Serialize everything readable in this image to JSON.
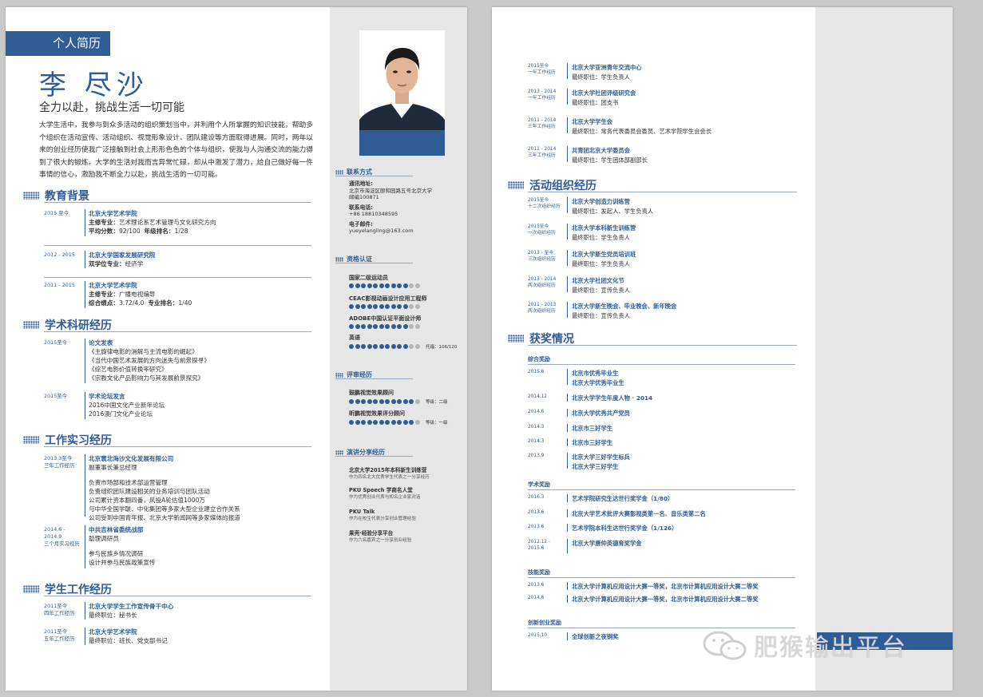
{
  "page1": {
    "badge": "个人简历",
    "name": "李 尽沙",
    "motto": "全力以赴，挑战生活一切可能",
    "intro": "大学生活中，我参与到众多活动的组织策划当中，并利用个人所掌握的知识技能，帮助多个组织在活动宣传、活动组织、视觉形象设计、团队建设等方面取得进展。同时，两年以来的创业经历使我广泛接触到社会上形形色色的个体与组织，使我与人沟通交流的能力得到了很大的锻炼。大学的生活对我而言异常忙碌，却从中激发了潜力，给自己做好每一件事情的信心，激励我不断全力以赴，挑战生活的一切可能。",
    "sections": {
      "education": "教育背景",
      "research": "学术科研经历",
      "work": "工作实习经历",
      "student": "学生工作经历"
    },
    "education": [
      {
        "date": "2015 至今",
        "school": "北京大学艺术学院",
        "l1k": "主修专业：",
        "l1v": "艺术理论系艺术管理与文化研究方向",
        "l2k": "平均分数：",
        "l2v": "92/100",
        "l2k2": "年级排名：",
        "l2v2": "1/28"
      },
      {
        "date": "2012 - 2015",
        "school": "北京大学国家发展研究院",
        "l1k": "双学位专业：",
        "l1v": "经济学"
      },
      {
        "date": "2011 - 2015",
        "school": "北京大学艺术学院",
        "l1k": "主修专业：",
        "l1v": "广播电视编导",
        "l2k": "综合绩点：",
        "l2v": "3.72/4.0",
        "l2k2": "专业排名：",
        "l2v2": "1/40"
      }
    ],
    "research": [
      {
        "date": "2015至今",
        "title": "论文发表",
        "lines": [
          "《主旋律电影的消解与主流电影的崛起》",
          "《当代中国艺术发展的方向迷失与前景探寻》",
          "《综艺电影价值转换率研究》",
          "《宗教文化产品影响力与其发展前景探究》"
        ]
      },
      {
        "date": "2015至今",
        "title": "学术论坛发言",
        "lines": [
          "2016中国文化产业新年论坛",
          "2016澳门文化产业论坛"
        ]
      }
    ],
    "work": [
      {
        "date": "2013.3至今",
        "date2": "三年工作经历",
        "title": "北京寰北海沙文化发展有限公司",
        "role": "副董事长兼总经理",
        "lines": [
          "负责市场部和技术部运营管理",
          "负责组织团队建设相关的业务培训与团队活动",
          "公司累计资本翻四番，风投A轮估值1000万",
          "与中华全国学联、中化集团等多家大型企业建立合作关系",
          "公司受到中国青年报、北京大学新闻网等多家媒体的报道"
        ]
      },
      {
        "date": "2014.6 - 2014.9",
        "date2": "三个月实习经历",
        "title": "中共吉林省委统战部",
        "role": "助理调研员",
        "lines": [
          "参与民族乡情况调研",
          "设计并参与民族政策宣传"
        ]
      }
    ],
    "student": [
      {
        "date": "2011至今",
        "date2": "四年工作经历",
        "title": "北京大学学生工作宣传骨干中心",
        "line": "最终职位：秘书长"
      },
      {
        "date": "2011至今",
        "date2": "五年工作经历",
        "title": "北京大学艺术学院",
        "line": "最终职位：班长、党支部书记"
      }
    ],
    "side": {
      "contact_title": "联系方式",
      "addr_k": "通讯地址:",
      "addr_v1": "北京市海淀区颐和园路五号北京大学",
      "addr_v2": "邮编100871",
      "phone_k": "联系电话:",
      "phone_v": "+86 18810348595",
      "email_k": "电子邮件:",
      "email_v": "yueyelangling@163.com",
      "cert_title": "资格认证",
      "skills": [
        {
          "label": "国家二级运动员",
          "on": 10,
          "total": 12,
          "note": ""
        },
        {
          "label": "CEAC影视动画设计应用工程师",
          "on": 10,
          "total": 12,
          "note": ""
        },
        {
          "label": "ADOBE中国认证平面设计师",
          "on": 10,
          "total": 12,
          "note": ""
        },
        {
          "label": "英语",
          "on": 10,
          "total": 12,
          "note": "托福：106/120"
        }
      ],
      "judge_title": "评审经历",
      "judges": [
        {
          "label": "鼓鹏视觉效果顾问",
          "on": 11,
          "total": 12,
          "note": "等级：二级"
        },
        {
          "label": "昕鹏视觉效果评分顾问",
          "on": 11,
          "total": 12,
          "note": "等级：一级"
        }
      ],
      "talk_title": "演讲分享经历",
      "talks": [
        {
          "t": "北京大学2015年本科新生训练营",
          "s": "作为四名北大优秀学生代表之一分享经历"
        },
        {
          "t": "PKU Speech 学商名人堂",
          "s": "作为优秀创业代表与知名企业家对话"
        },
        {
          "t": "PKU Talk",
          "s": "作为在校生代表分享创业管理经验"
        },
        {
          "t": "果壳·经验分享平台",
          "s": "作为六名嘉宾之一分享创业经验"
        }
      ]
    }
  },
  "page2": {
    "top": [
      {
        "date": "2015至今",
        "date2": "一年工作经历",
        "title": "北京大学亚洲青年交流中心",
        "line": "最终职位：学生负责人"
      },
      {
        "date": "2013 - 2014",
        "date2": "一年工作经历",
        "title": "北京大学社团评级研究会",
        "line": "最终职位：团支书"
      },
      {
        "date": "2011 - 2014",
        "date2": "三年工作经历",
        "title": "北京大学学生会",
        "line": "最终职位：常务代表委员会委员、艺术学院学生会会长"
      },
      {
        "date": "2011 - 2014",
        "date2": "三年工作经历",
        "title": "共青团北京大学委员会",
        "line": "最终职位：学生团体部副部长"
      }
    ],
    "activity_title": "活动组织经历",
    "activities": [
      {
        "date": "2015至今",
        "date2": "十二次组织经历",
        "title": "北京大学创造力训练营",
        "line": "最终职位：发起人、学生负责人"
      },
      {
        "date": "2015至今",
        "date2": "一次组织经历",
        "title": "北京大学本科新生训练营",
        "line": "最终职位：学生负责人"
      },
      {
        "date": "2013 - 至今",
        "date2": "三次组织经历",
        "title": "北京大学新生党员培训班",
        "line": "最终职位：学生负责人"
      },
      {
        "date": "2013 - 2014",
        "date2": "两次组织经历",
        "title": "北京大学社团文化节",
        "line": "最终职位：宣传负责人"
      },
      {
        "date": "2011 - 2013",
        "date2": "两次组织经历",
        "title": "北京大学新生晚会、毕业晚会、新年晚会",
        "line": "最终职位：宣传负责人"
      }
    ],
    "award_title": "获奖情况",
    "groups": [
      {
        "name": "综合奖励",
        "items": [
          {
            "date": "2015.6",
            "lines": [
              "北京市优秀毕业生",
              "北京大学优秀毕业生"
            ]
          },
          {
            "date": "2014.12",
            "lines": [
              "北京大学学生年度人物 · 2014"
            ]
          },
          {
            "date": "2014.6",
            "lines": [
              "北京大学优秀共产党员"
            ]
          },
          {
            "date": "2014.3",
            "lines": [
              "北京市三好学生"
            ]
          },
          {
            "date": "2014.3",
            "lines": [
              "北京市三好学生"
            ]
          },
          {
            "date": "2013.9",
            "lines": [
              "北京大学三好学生标兵",
              "北京大学三好学生"
            ]
          }
        ]
      },
      {
        "name": "学术奖励",
        "items": [
          {
            "date": "2016.3",
            "lines": [
              "艺术学院研究生达世行奖学金（1/80）"
            ]
          },
          {
            "date": "2013.6",
            "lines": [
              "北京大学艺术批评大赛影视类第一名、音乐类第二名"
            ]
          },
          {
            "date": "2013.6",
            "lines": [
              "艺术学院本科生达世行奖学金（1/126）"
            ]
          },
          {
            "date": "2012.12 - 2015.6",
            "lines": [
              "北京大学唐仲英德育奖学金"
            ]
          }
        ]
      },
      {
        "name": "技能奖励",
        "items": [
          {
            "date": "2013.6",
            "lines": [
              "北京大学计算机应用设计大赛一等奖，北京市计算机应用设计大赛二等奖"
            ]
          },
          {
            "date": "2014.6",
            "lines": [
              "北京大学计算机应用设计大赛一等奖，北京市计算机应用设计大赛二等奖"
            ]
          }
        ]
      },
      {
        "name": "创新创业奖励",
        "items": [
          {
            "date": "2015.10",
            "lines": [
              "全球创新之夜铜奖"
            ]
          }
        ]
      }
    ]
  },
  "watermark": "肥猴输出平台",
  "colors": {
    "accent": "#2f5c94",
    "sidebar": "#e6e6e6",
    "background": "#c9c9c9"
  }
}
